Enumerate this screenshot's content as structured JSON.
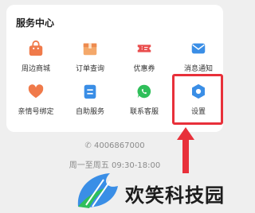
{
  "service_center": {
    "title": "服务中心",
    "items": [
      {
        "label": "周边商城",
        "icon": "shop-bag-icon"
      },
      {
        "label": "订单查询",
        "icon": "package-box-icon"
      },
      {
        "label": "优惠券",
        "icon": "ticket-icon"
      },
      {
        "label": "消息通知",
        "icon": "message-icon"
      },
      {
        "label": "亲情号绑定",
        "icon": "heart-icon"
      },
      {
        "label": "自助服务",
        "icon": "clipboard-icon"
      },
      {
        "label": "联系客服",
        "icon": "chat-icon"
      },
      {
        "label": "设置",
        "icon": "settings-icon"
      }
    ]
  },
  "contact": {
    "phone": "4006867000",
    "hours": "周一至周五 09:30-18:00"
  },
  "watermark": {
    "brand_name": "欢笑科技园"
  },
  "colors": {
    "highlight": "#e8303a",
    "accent_orange": "#f07a4a",
    "accent_blue": "#3a8ee6",
    "accent_green": "#2fbf5a",
    "accent_red": "#e94e4e"
  }
}
